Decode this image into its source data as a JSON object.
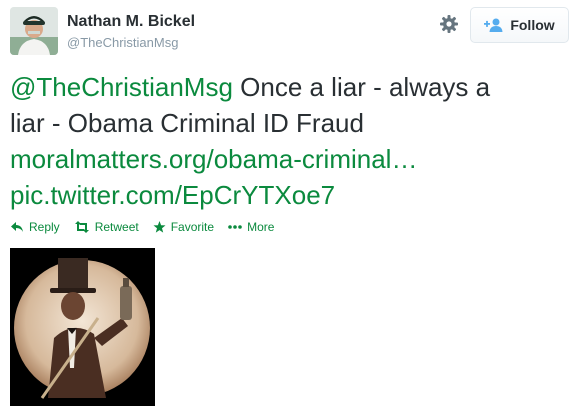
{
  "user": {
    "name": "Nathan M. Bickel",
    "handle": "@TheChristianMsg"
  },
  "follow_label": "Follow",
  "tweet": {
    "mention": "@TheChristianMsg",
    "text_part1": " Once a liar - always a",
    "text_part2": "liar - Obama Criminal ID Fraud",
    "link1": "moralmatters.org/obama-criminal…",
    "link2": "pic.twitter.com/EpCrYTXoe7"
  },
  "actions": {
    "reply": "Reply",
    "retweet": "Retweet",
    "favorite": "Favorite",
    "more": "More"
  },
  "colors": {
    "link": "#0b8a3e",
    "text": "#292f33",
    "muted": "#8899a6"
  }
}
